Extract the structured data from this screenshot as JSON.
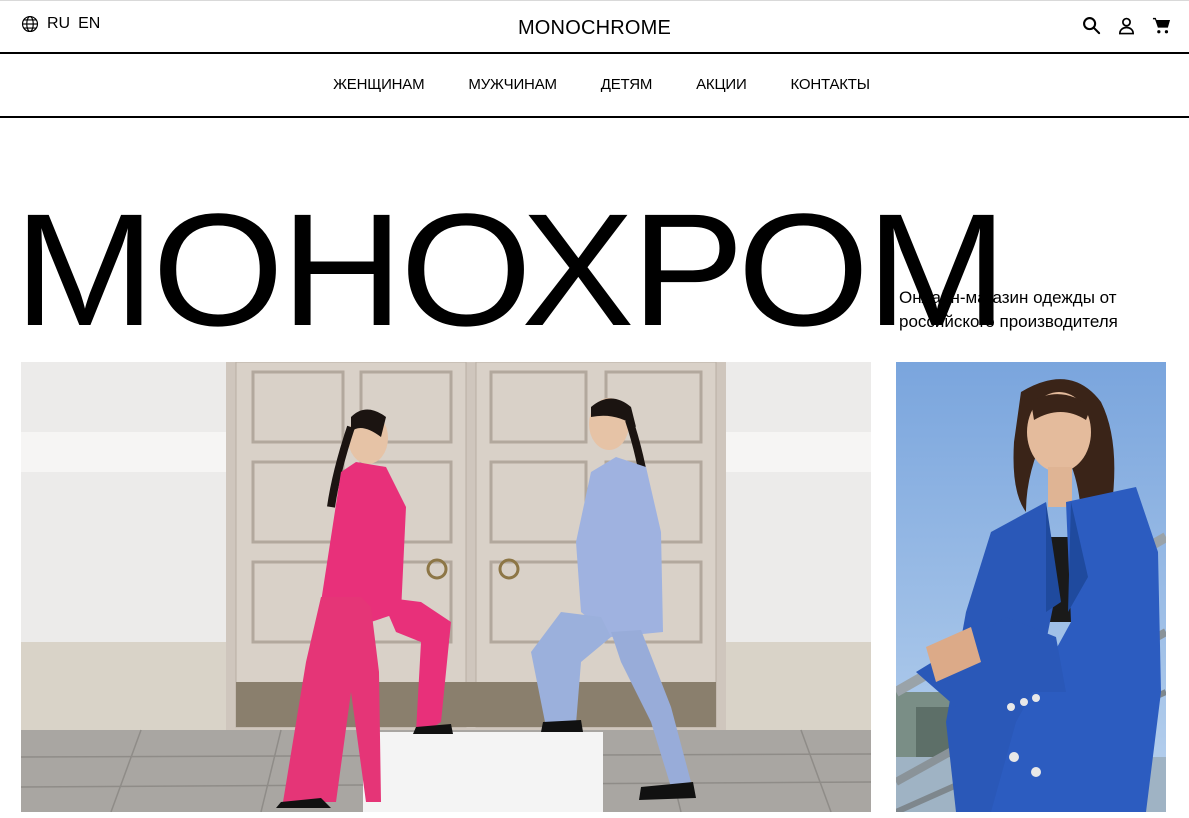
{
  "header": {
    "languages": [
      {
        "label": "RU",
        "active": true
      },
      {
        "label": "EN",
        "active": false
      }
    ],
    "logo": "MONOCHROME",
    "icons": [
      "globe-icon",
      "search-icon",
      "user-icon",
      "cart-icon"
    ]
  },
  "nav": {
    "items": [
      {
        "label": "ЖЕНЩИНАМ"
      },
      {
        "label": "МУЖЧИНАМ"
      },
      {
        "label": "ДЕТЯМ"
      },
      {
        "label": "АКЦИИ"
      },
      {
        "label": "КОНТАКТЫ"
      }
    ]
  },
  "hero": {
    "title": "МОНОХРОМ",
    "subtitle": "Онлайн-магазин одежды от российского производителя"
  },
  "colors": {
    "text": "#000000",
    "background": "#ffffff",
    "pink_suit": "#e8307a",
    "lavender_suit": "#9fb2e0",
    "cobalt_blazer": "#2a58b8"
  }
}
